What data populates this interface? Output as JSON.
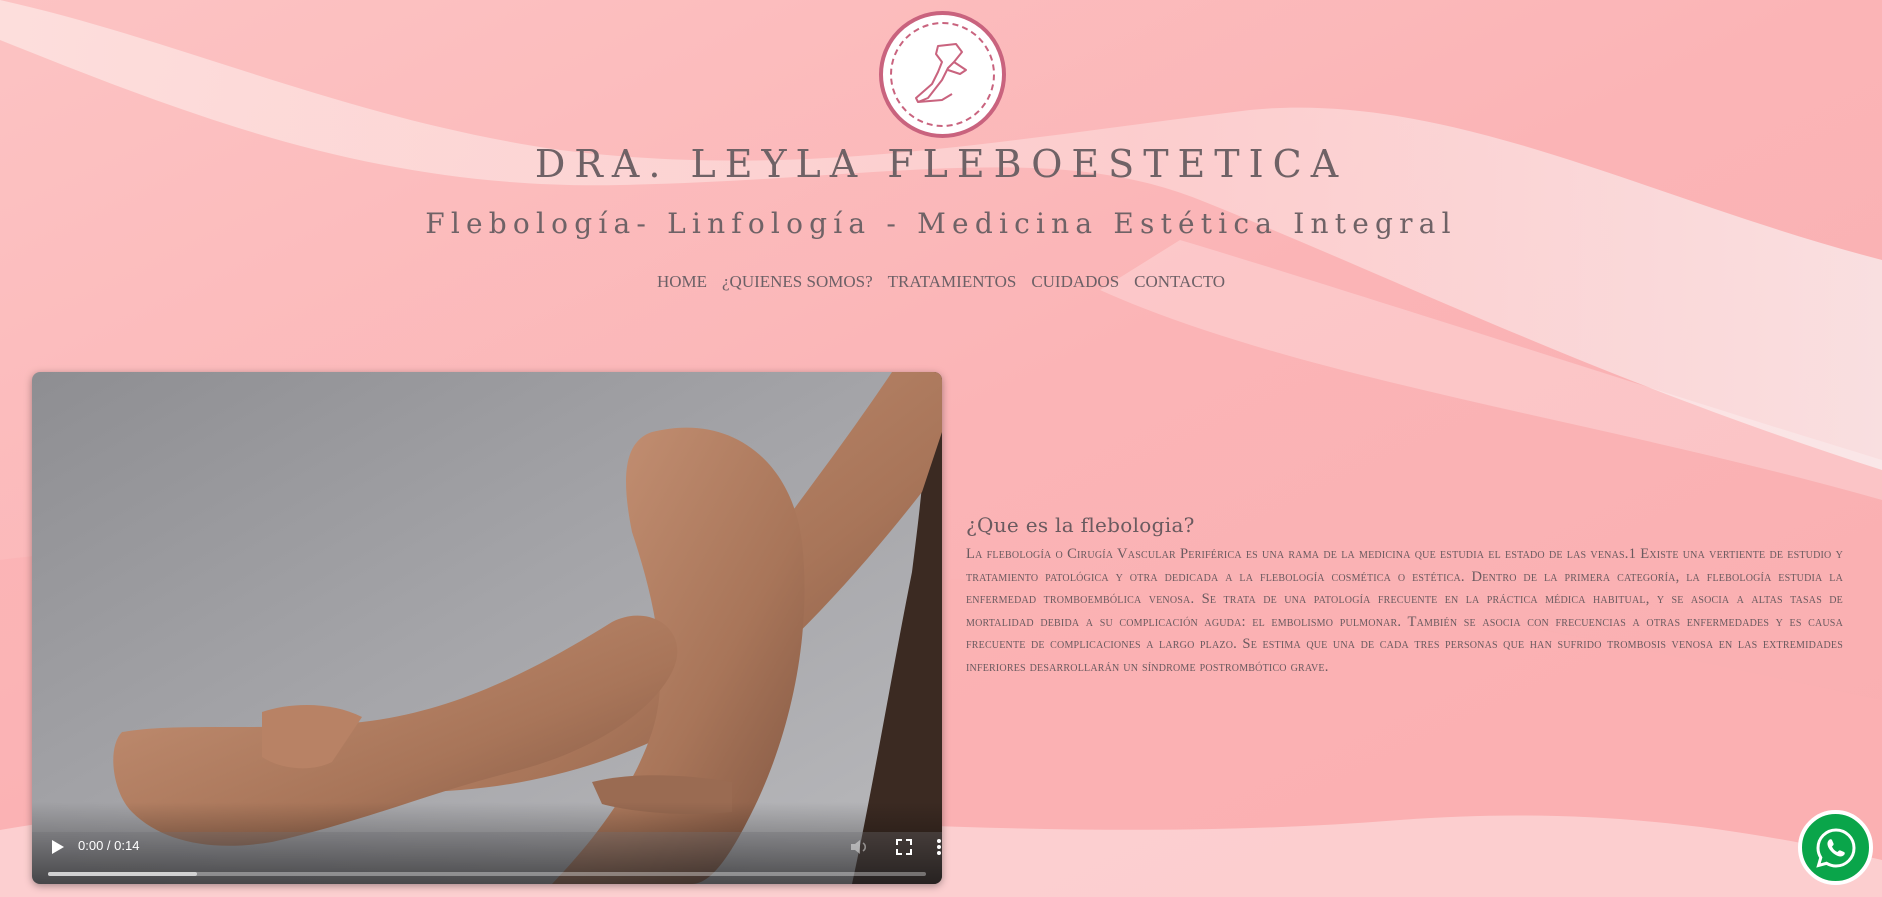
{
  "site": {
    "title": "DRA. LEYLA FLEBOESTETICA",
    "subtitle": "Flebología- Linfología - Medicina Estética Integral"
  },
  "nav": {
    "items": [
      {
        "label": "HOME"
      },
      {
        "label": "¿QUIENES SOMOS?"
      },
      {
        "label": "TRATAMIENTOS"
      },
      {
        "label": "CUIDADOS"
      },
      {
        "label": "CONTACTO"
      }
    ]
  },
  "video": {
    "time_display": "0:00 / 0:14",
    "buffered_fraction": 0.17
  },
  "article": {
    "heading": "¿Que es la flebologia?",
    "body": "La flebología o Cirugía Vascular Periférica es una rama de la medicina que estudia el estado de las venas.1 Existe una vertiente de estudio y tratamiento patológica y otra dedicada a la flebología cosmética o estética. Dentro de la primera categoría, la flebología estudia la enfermedad tromboembólica venosa. Se trata de una patología frecuente en la práctica médica habitual, y se asocia a altas tasas de mortalidad debida a su complicación aguda: el embolismo pulmonar. También se asocia con frecuencias a otras enfermedades y es causa frecuente de complicaciones a largo plazo. Se estima que una de cada tres personas que han sufrido trombosis venosa en las extremidades inferiores desarrollarán un síndrome postrombótico grave."
  },
  "icons": {
    "logo": "leg-logo-icon",
    "play": "play-icon",
    "mute": "volume-icon",
    "fullscreen": "fullscreen-icon",
    "more": "more-vert-icon",
    "whatsapp": "whatsapp-icon"
  },
  "colors": {
    "background": "#fbb9bb",
    "logo_accent": "#c9637e",
    "text": "#6a5a5f",
    "whatsapp": "#0aa54a"
  }
}
